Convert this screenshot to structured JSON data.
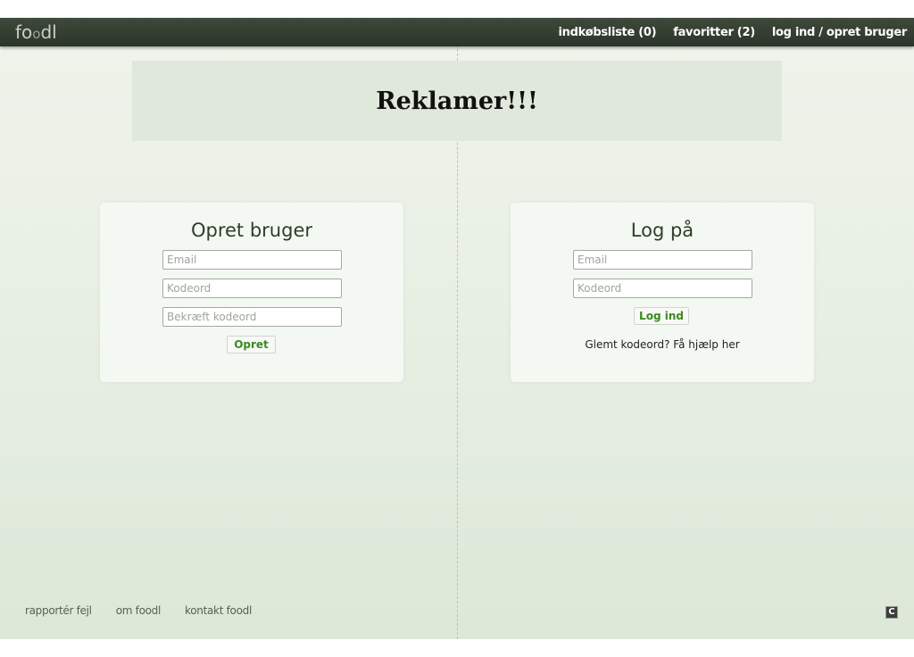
{
  "header": {
    "logo": {
      "part1": "fo",
      "mark": "o",
      "part2": "dl"
    },
    "nav": {
      "shopping_list": "indkøbsliste (0)",
      "favorites": "favoritter (2)",
      "login": "log ind / opret bruger"
    }
  },
  "ad": {
    "text": "Reklamer!!!"
  },
  "signup": {
    "title": "Opret bruger",
    "email_placeholder": "Email",
    "password_placeholder": "Kodeord",
    "confirm_placeholder": "Bekræft kodeord",
    "submit_label": "Opret"
  },
  "login": {
    "title": "Log på",
    "email_placeholder": "Email",
    "password_placeholder": "Kodeord",
    "submit_label": "Log ind",
    "forgot_text": "Glemt kodeord? Få hjælp her"
  },
  "footer": {
    "report_bug": "rapportér fejl",
    "about": "om foodl",
    "contact": "kontakt foodl",
    "badge": "C"
  },
  "colors": {
    "topbar": "#2f382d",
    "button_text": "#3a8a22",
    "background": "#e9f0e5"
  }
}
